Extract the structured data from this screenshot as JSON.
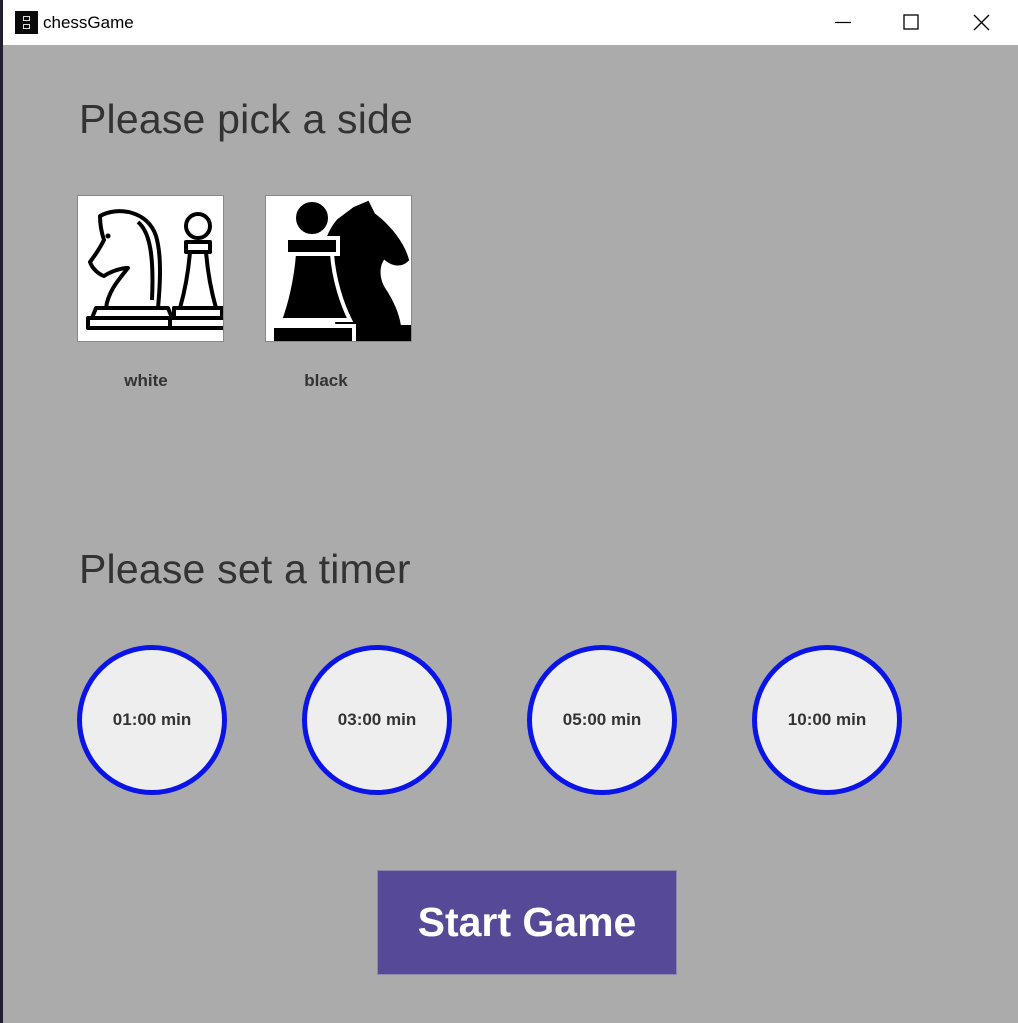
{
  "window": {
    "title": "chessGame",
    "icon": "chess-app-icon",
    "controls": [
      "minimize-icon",
      "maximize-icon",
      "close-icon"
    ]
  },
  "side_section": {
    "heading": "Please pick a side",
    "options": [
      {
        "label": "white",
        "icon": "white-knight-pawn-icon"
      },
      {
        "label": "black",
        "icon": "black-knight-pawn-icon"
      }
    ]
  },
  "timer_section": {
    "heading": "Please set a timer",
    "options": [
      {
        "label": "01:00 min"
      },
      {
        "label": "03:00 min"
      },
      {
        "label": "05:00 min"
      },
      {
        "label": "10:00 min"
      }
    ]
  },
  "start_button": {
    "label": "Start Game"
  },
  "colors": {
    "background": "#ababab",
    "accent_button": "#554998",
    "timer_ring": "#0a14e6",
    "text": "#333333"
  }
}
